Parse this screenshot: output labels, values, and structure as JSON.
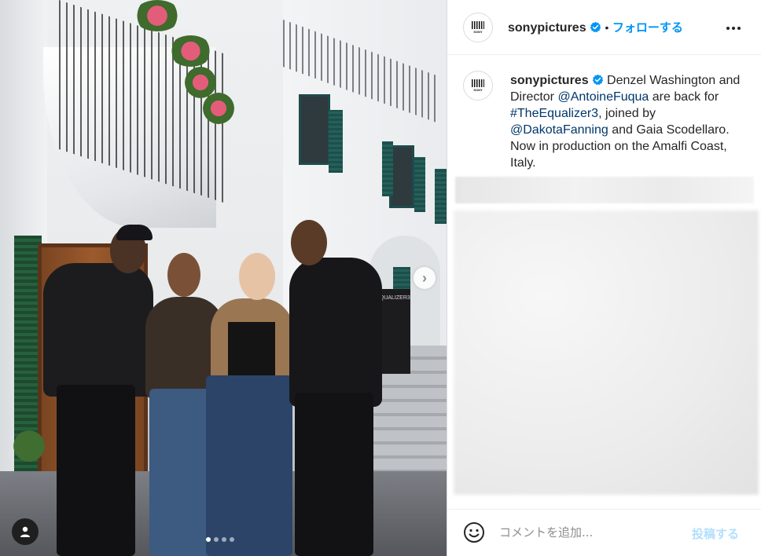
{
  "post": {
    "username": "sonypictures",
    "follow_label": "フォローする",
    "separator": "•",
    "caption": {
      "username": "sonypictures",
      "segments": [
        {
          "text": " Denzel Washington and Director ",
          "type": "text"
        },
        {
          "text": "@AntoineFuqua",
          "type": "link"
        },
        {
          "text": " are back for ",
          "type": "text"
        },
        {
          "text": "#TheEqualizer3",
          "type": "link"
        },
        {
          "text": ", joined by ",
          "type": "text"
        },
        {
          "text": "@DakotaFanning",
          "type": "link"
        },
        {
          "text": " and Gaia Scodellaro. Now in production on the Amalfi Coast, Italy.",
          "type": "text"
        }
      ]
    },
    "sign_text": "EQUALIZER3"
  },
  "media": {
    "carousel": {
      "total": 4,
      "active_index": 0
    },
    "icons": {
      "next": "chevron-right-icon",
      "tags": "user-tag-icon"
    }
  },
  "comment_box": {
    "placeholder": "コメントを追加...",
    "post_label": "投稿する"
  },
  "colors": {
    "accent": "#0095f6",
    "link": "#00376b",
    "post_disabled": "#b2dffc",
    "text": "#262626",
    "muted": "#8e8e8e"
  }
}
